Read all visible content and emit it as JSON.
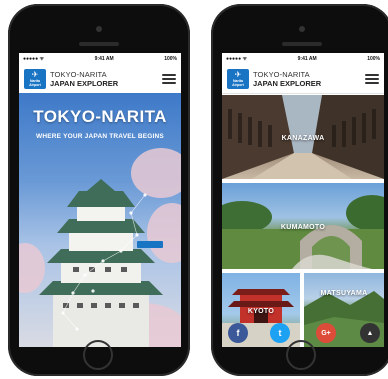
{
  "status": {
    "left": "●●●●● ᯤ",
    "time": "9:41 AM",
    "battery": "100%"
  },
  "brand": {
    "logo_text": "Narita Airport",
    "line1": "TOKYO-NARITA",
    "line2": "JAPAN EXPLORER"
  },
  "hero": {
    "title": "TOKYO-NARITA",
    "subtitle": "WHERE YOUR JAPAN TRAVEL BEGINS"
  },
  "destinations": [
    {
      "label": "KANAZAWA"
    },
    {
      "label": "KUMAMOTO"
    },
    {
      "label": "KYOTO"
    },
    {
      "label": "MATSUYAMA"
    }
  ],
  "social": {
    "facebook": "f",
    "twitter": "t",
    "google": "G+",
    "scroll_top": "▲"
  },
  "icons": [
    "plane-icon",
    "menu-icon",
    "facebook-icon",
    "twitter-icon",
    "google-plus-icon",
    "scroll-up-icon"
  ]
}
